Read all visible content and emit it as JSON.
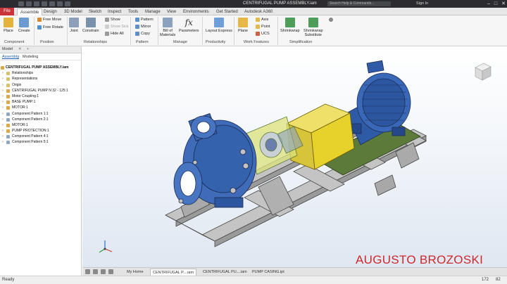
{
  "titlebar": {
    "window_title": "CENTRIFUGAL PUMP ASSEMBLY.iam",
    "search_placeholder": "Search Help & Commands...",
    "sign_in": "Sign In"
  },
  "tabs": {
    "file": "File",
    "items": [
      "Assemble",
      "Design",
      "3D Model",
      "Sketch",
      "Inspect",
      "Tools",
      "Manage",
      "View",
      "Environments",
      "Get Started",
      "Autodesk A360"
    ]
  },
  "ribbon": {
    "component": {
      "place": "Place",
      "create": "Create",
      "label": "Component"
    },
    "position": {
      "free_move": "Free Move",
      "free_rotate": "Free Rotate",
      "label": "Position"
    },
    "relationships": {
      "joint": "Joint",
      "constrain": "Constrain",
      "show": "Show",
      "show_sick": "Show Sick",
      "hide_all": "Hide All",
      "label": "Relationships"
    },
    "pattern": {
      "pattern": "Pattern",
      "mirror": "Mirror",
      "copy": "Copy",
      "label": "Pattern"
    },
    "manage": {
      "bom_line1": "Bill of",
      "bom_line2": "Materials",
      "parameters": "Parameters",
      "label": "Manage"
    },
    "productivity": {
      "layout_express": "Layout Express",
      "label": "Productivity"
    },
    "work_features": {
      "plane": "Plane",
      "axis": "Axis",
      "point": "Point",
      "ucs": "UCS",
      "label": "Work Features"
    },
    "simplification": {
      "shrinkwrap": "Shrinkwrap",
      "shrinkwrap_sub_1": "Shrinkwrap",
      "shrinkwrap_sub_2": "Substitute",
      "label": "Simplification"
    }
  },
  "browser": {
    "tab_model": "Model",
    "sub_assembly": "Assembly",
    "sub_modeling": "Modeling",
    "root": "CENTRIFUGAL PUMP ASSEMBLY.iam",
    "nodes": [
      "Relationships",
      "Representations",
      "Origin",
      "CENTRIFUGAL PUMP N 32 - 125:1",
      "Motor Coupling:1",
      "BASE PUMP:1",
      "MOTOR:1",
      "Component Pattern 1:1",
      "Component Pattern 2:1",
      "MOTOR:1",
      "PUMP PROTECTION:1",
      "Component Pattern 4:1",
      "Component Pattern 5:1"
    ]
  },
  "viewport": {
    "watermark": "AUGUSTO BROZOSKI"
  },
  "doctabs": {
    "items": [
      "My Home",
      "CENTRIFUGAL P....iam",
      "CENTRIFUGAL PU....iam",
      "PUMP CASING.ipt"
    ]
  },
  "status": {
    "ready": "Ready",
    "count_a": "172",
    "count_b": "82"
  },
  "colors": {
    "file_tab": "#c9333a",
    "pump_blue": "#2e5aa8",
    "guard_yellow": "#e6d22a",
    "base_gray": "#bdbdbd",
    "watermark": "#d0262d"
  }
}
